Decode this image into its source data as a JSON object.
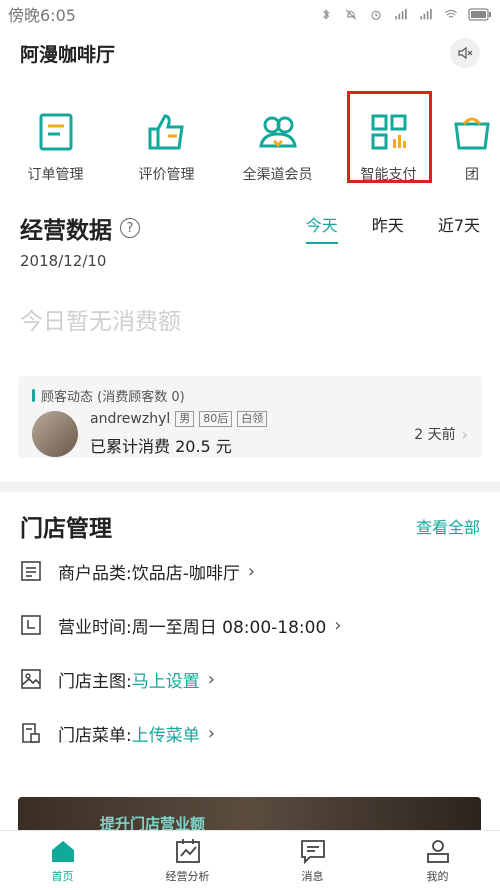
{
  "status_bar": {
    "time": "傍晚6:05"
  },
  "header": {
    "shop_name": "阿漫咖啡厅"
  },
  "shortcuts": [
    {
      "label": "订单管理",
      "icon": "order-icon"
    },
    {
      "label": "评价管理",
      "icon": "thumbs-up-icon"
    },
    {
      "label": "全渠道会员",
      "icon": "members-icon"
    },
    {
      "label": "智能支付",
      "icon": "qr-pay-icon"
    },
    {
      "label": "团",
      "icon": "group-buy-icon"
    }
  ],
  "business": {
    "title": "经营数据",
    "help_label": "?",
    "tabs": [
      "今天",
      "昨天",
      "近7天"
    ],
    "active_tab": "今天",
    "date": "2018/12/10",
    "empty_text": "今日暂无消费额"
  },
  "customer_card": {
    "title": "顾客动态 (消费顾客数 0)",
    "name": "andrewzhyl",
    "tags": [
      "男",
      "80后",
      "白领"
    ],
    "spent": "已累计消费 20.5 元",
    "time": "2 天前"
  },
  "store": {
    "title": "门店管理",
    "view_all": "查看全部",
    "rows": [
      {
        "label": "商户品类:",
        "value": "饮品店-咖啡厅",
        "icon": "list-icon"
      },
      {
        "label": "营业时间:",
        "value": "周一至周日 08:00-18:00",
        "icon": "clock-icon"
      },
      {
        "label": "门店主图:",
        "value": "马上设置",
        "icon": "image-icon"
      },
      {
        "label": "门店菜单:",
        "value": "上传菜单",
        "icon": "menu-doc-icon"
      }
    ]
  },
  "banner": {
    "text": "提升门店营业额"
  },
  "tab_bar": [
    {
      "label": "首页",
      "icon": "home-icon"
    },
    {
      "label": "经营分析",
      "icon": "chart-icon"
    },
    {
      "label": "消息",
      "icon": "message-icon"
    },
    {
      "label": "我的",
      "icon": "profile-icon"
    }
  ],
  "colors": {
    "accent": "#12a99a",
    "highlight_box": "#e0221b"
  }
}
